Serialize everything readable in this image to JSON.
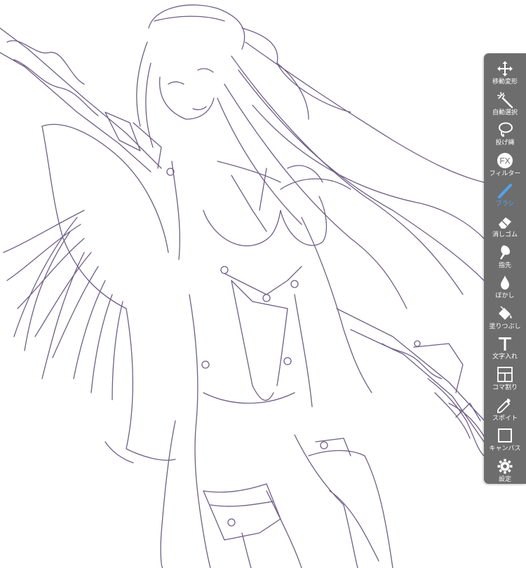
{
  "toolbar": {
    "accent_color": "#4fa3f0",
    "tools": [
      {
        "label": "移動変形",
        "icon": "move-icon"
      },
      {
        "label": "自動選択",
        "icon": "magic-wand-icon"
      },
      {
        "label": "投げ縄",
        "icon": "lasso-icon"
      },
      {
        "label": "フィルター",
        "icon": "fx-filter-icon",
        "icon_text": "FX"
      },
      {
        "label": "ブラシ",
        "icon": "brush-icon",
        "active": true
      },
      {
        "label": "消しゴム",
        "icon": "eraser-icon"
      },
      {
        "label": "指先",
        "icon": "finger-smudge-icon"
      },
      {
        "label": "ぼかし",
        "icon": "blur-drop-icon"
      },
      {
        "label": "塗りつぶし",
        "icon": "bucket-fill-icon"
      },
      {
        "label": "文字入れ",
        "icon": "text-icon",
        "icon_text": "T"
      },
      {
        "label": "コマ割り",
        "icon": "panel-divide-icon"
      },
      {
        "label": "スポイト",
        "icon": "eyedropper-icon"
      },
      {
        "label": "キャンバス",
        "icon": "canvas-icon"
      },
      {
        "label": "設定",
        "icon": "gear-icon"
      }
    ]
  }
}
